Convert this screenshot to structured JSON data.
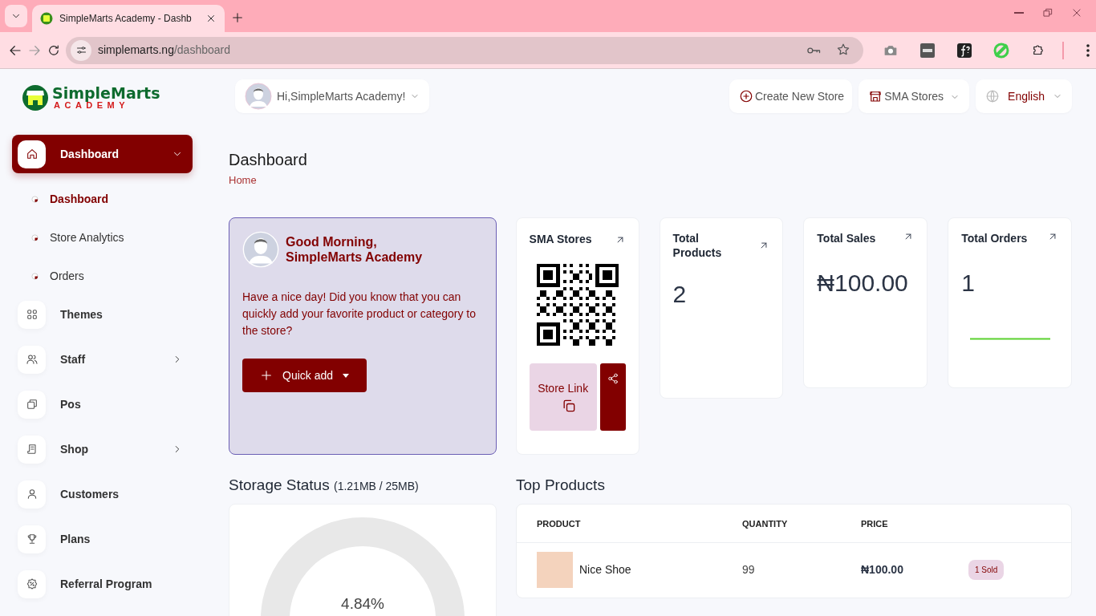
{
  "browser": {
    "tab_title": "SimpleMarts Academy - Dashb",
    "url_host": "simplemarts.ng",
    "url_path": "/dashboard"
  },
  "logo": {
    "name": "SimpleMarts",
    "tagline": "ACADEMY"
  },
  "sidebar": {
    "items": [
      {
        "label": "Dashboard",
        "kind": "group",
        "expanded": true,
        "selected": true,
        "children": [
          {
            "label": "Dashboard",
            "selected": true
          },
          {
            "label": "Store Analytics",
            "selected": false
          },
          {
            "label": "Orders",
            "selected": false
          }
        ]
      },
      {
        "label": "Themes",
        "kind": "link",
        "selected": false
      },
      {
        "label": "Staff",
        "kind": "group",
        "expanded": false,
        "selected": false
      },
      {
        "label": "Pos",
        "kind": "link",
        "selected": false
      },
      {
        "label": "Shop",
        "kind": "group",
        "expanded": false,
        "selected": false
      },
      {
        "label": "Customers",
        "kind": "link",
        "selected": false
      },
      {
        "label": "Plans",
        "kind": "link",
        "selected": false
      },
      {
        "label": "Referral Program",
        "kind": "link",
        "selected": false
      }
    ]
  },
  "header": {
    "greeting": "Hi,SimpleMarts Academy!",
    "create_store": "Create New Store",
    "store_selector": "SMA Stores",
    "language": "English"
  },
  "page": {
    "title": "Dashboard",
    "breadcrumb": "Home"
  },
  "welcome": {
    "title_line1": "Good Morning,",
    "title_line2": "SimpleMarts Academy",
    "message": "Have a nice day! Did you know that you can quickly add your favorite product or category to the store?",
    "button": "Quick add"
  },
  "store_card": {
    "title": "SMA Stores",
    "link_button": "Store Link"
  },
  "stats": [
    {
      "title": "Total Products",
      "value": "2",
      "kind": "plain"
    },
    {
      "title": "Total Sales",
      "value": "₦100.00",
      "kind": "plain"
    },
    {
      "title": "Total Orders",
      "value": "1",
      "kind": "sparkline"
    }
  ],
  "storage": {
    "title": "Storage Status",
    "usage": "(1.21MB / 25MB)",
    "percent": "4.84%"
  },
  "top_products": {
    "title": "Top Products",
    "columns": [
      "PRODUCT",
      "QUANTITY",
      "PRICE"
    ],
    "rows": [
      {
        "product": "Nice Shoe",
        "quantity": "99",
        "price": "₦100.00",
        "badge": "1 Sold"
      }
    ]
  }
}
